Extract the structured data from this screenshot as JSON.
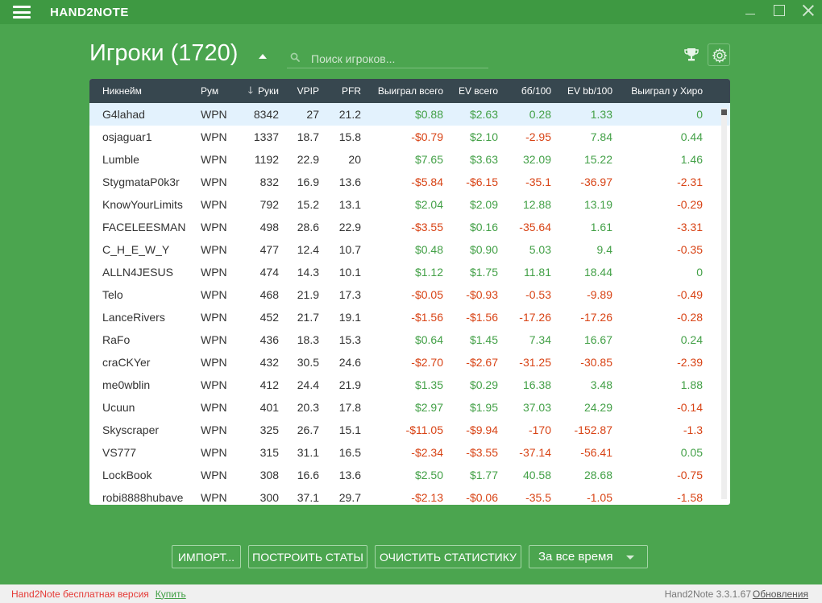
{
  "app": {
    "title": "HAND2NOTE"
  },
  "header": {
    "title": "Игроки (1720)",
    "search_placeholder": "Поиск игроков..."
  },
  "table": {
    "columns": {
      "name": "Никнейм",
      "room": "Рум",
      "hands": "Руки",
      "vpip": "VPIP",
      "pfr": "PFR",
      "won": "Выиграл всего",
      "ev": "EV всего",
      "bb100": "бб/100",
      "evbb100": "EV bb/100",
      "vs_hero": "Выиграл у Хиро"
    },
    "rows": [
      {
        "name": "G4lahad",
        "room": "WPN",
        "hands": "8342",
        "vpip": "27",
        "pfr": "21.2",
        "won": "$0.88",
        "ev": "$2.63",
        "bb100": "0.28",
        "evbb100": "1.33",
        "vs_hero": "0"
      },
      {
        "name": "osjaguar1",
        "room": "WPN",
        "hands": "1337",
        "vpip": "18.7",
        "pfr": "15.8",
        "won": "-$0.79",
        "ev": "$2.10",
        "bb100": "-2.95",
        "evbb100": "7.84",
        "vs_hero": "0.44"
      },
      {
        "name": "Lumble",
        "room": "WPN",
        "hands": "1192",
        "vpip": "22.9",
        "pfr": "20",
        "won": "$7.65",
        "ev": "$3.63",
        "bb100": "32.09",
        "evbb100": "15.22",
        "vs_hero": "1.46"
      },
      {
        "name": "StygmataP0k3r",
        "room": "WPN",
        "hands": "832",
        "vpip": "16.9",
        "pfr": "13.6",
        "won": "-$5.84",
        "ev": "-$6.15",
        "bb100": "-35.1",
        "evbb100": "-36.97",
        "vs_hero": "-2.31"
      },
      {
        "name": "KnowYourLimits",
        "room": "WPN",
        "hands": "792",
        "vpip": "15.2",
        "pfr": "13.1",
        "won": "$2.04",
        "ev": "$2.09",
        "bb100": "12.88",
        "evbb100": "13.19",
        "vs_hero": "-0.29"
      },
      {
        "name": "FACELEESMAN",
        "room": "WPN",
        "hands": "498",
        "vpip": "28.6",
        "pfr": "22.9",
        "won": "-$3.55",
        "ev": "$0.16",
        "bb100": "-35.64",
        "evbb100": "1.61",
        "vs_hero": "-3.31"
      },
      {
        "name": "C_H_E_W_Y",
        "room": "WPN",
        "hands": "477",
        "vpip": "12.4",
        "pfr": "10.7",
        "won": "$0.48",
        "ev": "$0.90",
        "bb100": "5.03",
        "evbb100": "9.4",
        "vs_hero": "-0.35"
      },
      {
        "name": "ALLN4JESUS",
        "room": "WPN",
        "hands": "474",
        "vpip": "14.3",
        "pfr": "10.1",
        "won": "$1.12",
        "ev": "$1.75",
        "bb100": "11.81",
        "evbb100": "18.44",
        "vs_hero": "0"
      },
      {
        "name": "Telo",
        "room": "WPN",
        "hands": "468",
        "vpip": "21.9",
        "pfr": "17.3",
        "won": "-$0.05",
        "ev": "-$0.93",
        "bb100": "-0.53",
        "evbb100": "-9.89",
        "vs_hero": "-0.49"
      },
      {
        "name": "LanceRivers",
        "room": "WPN",
        "hands": "452",
        "vpip": "21.7",
        "pfr": "19.1",
        "won": "-$1.56",
        "ev": "-$1.56",
        "bb100": "-17.26",
        "evbb100": "-17.26",
        "vs_hero": "-0.28"
      },
      {
        "name": "RaFo",
        "room": "WPN",
        "hands": "436",
        "vpip": "18.3",
        "pfr": "15.3",
        "won": "$0.64",
        "ev": "$1.45",
        "bb100": "7.34",
        "evbb100": "16.67",
        "vs_hero": "0.24"
      },
      {
        "name": "craCKYer",
        "room": "WPN",
        "hands": "432",
        "vpip": "30.5",
        "pfr": "24.6",
        "won": "-$2.70",
        "ev": "-$2.67",
        "bb100": "-31.25",
        "evbb100": "-30.85",
        "vs_hero": "-2.39"
      },
      {
        "name": "me0wblin",
        "room": "WPN",
        "hands": "412",
        "vpip": "24.4",
        "pfr": "21.9",
        "won": "$1.35",
        "ev": "$0.29",
        "bb100": "16.38",
        "evbb100": "3.48",
        "vs_hero": "1.88"
      },
      {
        "name": "Ucuun",
        "room": "WPN",
        "hands": "401",
        "vpip": "20.3",
        "pfr": "17.8",
        "won": "$2.97",
        "ev": "$1.95",
        "bb100": "37.03",
        "evbb100": "24.29",
        "vs_hero": "-0.14"
      },
      {
        "name": "Skyscraper",
        "room": "WPN",
        "hands": "325",
        "vpip": "26.7",
        "pfr": "15.1",
        "won": "-$11.05",
        "ev": "-$9.94",
        "bb100": "-170",
        "evbb100": "-152.87",
        "vs_hero": "-1.3"
      },
      {
        "name": "VS777",
        "room": "WPN",
        "hands": "315",
        "vpip": "31.1",
        "pfr": "16.5",
        "won": "-$2.34",
        "ev": "-$3.55",
        "bb100": "-37.14",
        "evbb100": "-56.41",
        "vs_hero": "0.05"
      },
      {
        "name": "LockBook",
        "room": "WPN",
        "hands": "308",
        "vpip": "16.6",
        "pfr": "13.6",
        "won": "$2.50",
        "ev": "$1.77",
        "bb100": "40.58",
        "evbb100": "28.68",
        "vs_hero": "-0.75"
      },
      {
        "name": "robi8888hubave",
        "room": "WPN",
        "hands": "300",
        "vpip": "37.1",
        "pfr": "29.7",
        "won": "-$2.13",
        "ev": "-$0.06",
        "bb100": "-35.5",
        "evbb100": "-1.05",
        "vs_hero": "-1.58"
      }
    ],
    "selected_row": 0,
    "sort_column": "hands"
  },
  "buttons": {
    "import": "ИМПОРТ...",
    "build_stats": "ПОСТРОИТЬ СТАТЫ",
    "clear_stats": "ОЧИСТИТЬ СТАТИСТИКУ",
    "period": "За все время"
  },
  "status": {
    "free_version": "Hand2Note бесплатная версия",
    "buy": "Купить",
    "version": "Hand2Note 3.3.1.67",
    "updates": "Обновления"
  },
  "icons": {
    "menu": "hamburger-menu-icon",
    "search": "search-icon",
    "trophy": "trophy-icon",
    "settings": "gear-icon",
    "sort": "sort-down-arrow-icon"
  },
  "colors": {
    "background": "#4ba54f",
    "titlebar": "#3e9942",
    "table_header": "#37474f",
    "positive": "#43a047",
    "negative": "#d84315",
    "selected_row": "#e3f2fd",
    "free_label": "#e53935"
  }
}
